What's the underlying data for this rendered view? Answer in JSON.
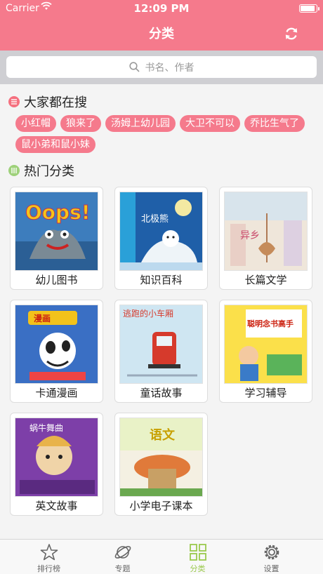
{
  "status": {
    "carrier": "Carrier",
    "time": "12:09 PM"
  },
  "nav": {
    "title": "分类",
    "refresh_icon": "refresh-icon"
  },
  "search": {
    "placeholder": "书名、作者",
    "icon": "search-icon"
  },
  "hot_search": {
    "title": "大家都在搜",
    "tags": [
      "小红帽",
      "狼来了",
      "汤姆上幼儿园",
      "大卫不可以",
      "乔比生气了",
      "鼠小弟和鼠小妹"
    ]
  },
  "categories": {
    "title": "热门分类",
    "items": [
      {
        "label": "幼儿图书",
        "cover_text": "Oops!"
      },
      {
        "label": "知识百科",
        "cover_text": "北极熊"
      },
      {
        "label": "长篇文学",
        "cover_text": "异乡"
      },
      {
        "label": "卡通漫画",
        "cover_text": "漫画"
      },
      {
        "label": "童话故事",
        "cover_text": "逃跑的小车厢"
      },
      {
        "label": "学习辅导",
        "cover_text": "聪明念书高手"
      },
      {
        "label": "英文故事",
        "cover_text": "蜗牛舞曲"
      },
      {
        "label": "小学电子课本",
        "cover_text": "语文"
      }
    ]
  },
  "tabbar": {
    "items": [
      {
        "label": "排行榜",
        "icon": "star-icon"
      },
      {
        "label": "专题",
        "icon": "planet-icon"
      },
      {
        "label": "分类",
        "icon": "grid-icon",
        "active": true
      },
      {
        "label": "设置",
        "icon": "gear-icon"
      }
    ]
  },
  "colors": {
    "accent": "#f57a8c",
    "active_tab": "#9bc94e",
    "section_red": "#f5707f",
    "section_green": "#9ed17a"
  }
}
